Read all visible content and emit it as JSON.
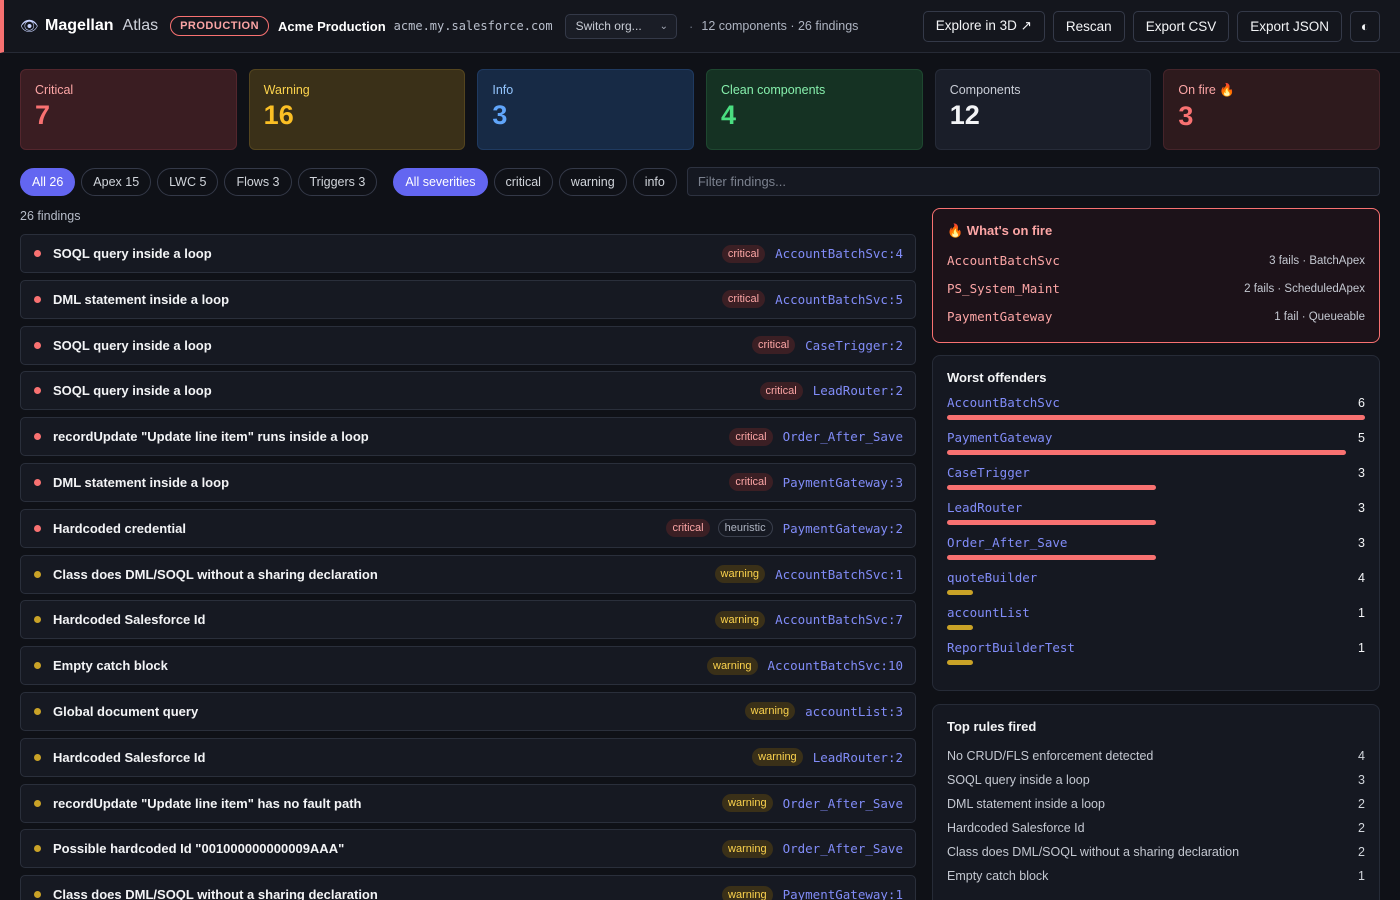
{
  "header": {
    "brand_name": "Magellan",
    "brand_sub": "Atlas",
    "env_badge": "PRODUCTION",
    "org_name": "Acme Production",
    "org_url": "acme.my.salesforce.com",
    "org_select": "Switch org...",
    "separator": "·",
    "summary": "12 components · 26 findings",
    "actions": {
      "explore": "Explore in 3D ↗",
      "rescan": "Rescan",
      "export_csv": "Export CSV",
      "export_json": "Export JSON",
      "theme": "◐"
    }
  },
  "stats": [
    {
      "label": "Critical",
      "value": "7"
    },
    {
      "label": "Warning",
      "value": "16"
    },
    {
      "label": "Info",
      "value": "3"
    },
    {
      "label": "Clean components",
      "value": "4"
    },
    {
      "label": "Components",
      "value": "12"
    },
    {
      "label": "On fire 🔥",
      "value": "3"
    }
  ],
  "filters": {
    "types": [
      "All 26",
      "Apex 15",
      "LWC 5",
      "Flows 3",
      "Triggers 3"
    ],
    "severities": [
      "All severities",
      "critical",
      "warning",
      "info"
    ],
    "search_placeholder": "Filter findings..."
  },
  "findings_count": "26 findings",
  "findings": [
    {
      "title": "SOQL query inside a loop",
      "severity": "critical",
      "heuristic": "",
      "location": "AccountBatchSvc:4"
    },
    {
      "title": "DML statement inside a loop",
      "severity": "critical",
      "heuristic": "",
      "location": "AccountBatchSvc:5"
    },
    {
      "title": "SOQL query inside a loop",
      "severity": "critical",
      "heuristic": "",
      "location": "CaseTrigger:2"
    },
    {
      "title": "SOQL query inside a loop",
      "severity": "critical",
      "heuristic": "",
      "location": "LeadRouter:2"
    },
    {
      "title": "recordUpdate \"Update line item\" runs inside a loop",
      "severity": "critical",
      "heuristic": "",
      "location": "Order_After_Save"
    },
    {
      "title": "DML statement inside a loop",
      "severity": "critical",
      "heuristic": "",
      "location": "PaymentGateway:3"
    },
    {
      "title": "Hardcoded credential",
      "severity": "critical",
      "heuristic": "heuristic",
      "location": "PaymentGateway:2"
    },
    {
      "title": "Class does DML/SOQL without a sharing declaration",
      "severity": "warning",
      "heuristic": "",
      "location": "AccountBatchSvc:1"
    },
    {
      "title": "Hardcoded Salesforce Id",
      "severity": "warning",
      "heuristic": "",
      "location": "AccountBatchSvc:7"
    },
    {
      "title": "Empty catch block",
      "severity": "warning",
      "heuristic": "",
      "location": "AccountBatchSvc:10"
    },
    {
      "title": "Global document query",
      "severity": "warning",
      "heuristic": "",
      "location": "accountList:3"
    },
    {
      "title": "Hardcoded Salesforce Id",
      "severity": "warning",
      "heuristic": "",
      "location": "LeadRouter:2"
    },
    {
      "title": "recordUpdate \"Update line item\" has no fault path",
      "severity": "warning",
      "heuristic": "",
      "location": "Order_After_Save"
    },
    {
      "title": "Possible hardcoded Id \"001000000000009AAA\"",
      "severity": "warning",
      "heuristic": "",
      "location": "Order_After_Save"
    },
    {
      "title": "Class does DML/SOQL without a sharing declaration",
      "severity": "warning",
      "heuristic": "",
      "location": "PaymentGateway:1"
    }
  ],
  "on_fire": {
    "title": "🔥 What's on fire",
    "items": [
      {
        "name": "AccountBatchSvc",
        "meta": "3 fails · BatchApex"
      },
      {
        "name": "PS_System_Maint",
        "meta": "2 fails · ScheduledApex"
      },
      {
        "name": "PaymentGateway",
        "meta": "1 fail · Queueable"
      }
    ]
  },
  "offenders": {
    "title": "Worst offenders",
    "items": [
      {
        "name": "AccountBatchSvc",
        "count": "6",
        "fill": 1.0,
        "severity": "critical"
      },
      {
        "name": "PaymentGateway",
        "count": "5",
        "fill": 0.955,
        "severity": "critical"
      },
      {
        "name": "CaseTrigger",
        "count": "3",
        "fill": 0.5,
        "severity": "critical"
      },
      {
        "name": "LeadRouter",
        "count": "3",
        "fill": 0.5,
        "severity": "critical"
      },
      {
        "name": "Order_After_Save",
        "count": "3",
        "fill": 0.5,
        "severity": "critical"
      },
      {
        "name": "quoteBuilder",
        "count": "4",
        "fill": 0.06,
        "severity": "warning"
      },
      {
        "name": "accountList",
        "count": "1",
        "fill": 0.06,
        "severity": "warning"
      },
      {
        "name": "ReportBuilderTest",
        "count": "1",
        "fill": 0.06,
        "severity": "warning"
      }
    ]
  },
  "rules": {
    "title": "Top rules fired",
    "items": [
      {
        "name": "No CRUD/FLS enforcement detected",
        "count": "4"
      },
      {
        "name": "SOQL query inside a loop",
        "count": "3"
      },
      {
        "name": "DML statement inside a loop",
        "count": "2"
      },
      {
        "name": "Hardcoded Salesforce Id",
        "count": "2"
      },
      {
        "name": "Class does DML/SOQL without a sharing declaration",
        "count": "2"
      },
      {
        "name": "Empty catch block",
        "count": "1"
      }
    ]
  },
  "colors": {
    "critical": "#f87171",
    "warning": "#c9a227",
    "accent": "#6366f1",
    "link": "#818cf8",
    "offender_critical": "#f87171",
    "offender_warning": "#c9a227"
  }
}
